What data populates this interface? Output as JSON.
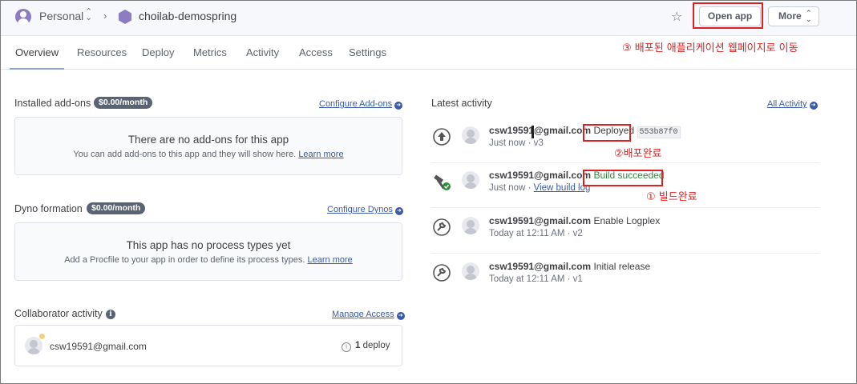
{
  "header": {
    "team": "Personal",
    "app_name": "choilab-demospring",
    "open_app": "Open app",
    "more": "More"
  },
  "tabs": [
    "Overview",
    "Resources",
    "Deploy",
    "Metrics",
    "Activity",
    "Access",
    "Settings"
  ],
  "addons": {
    "title": "Installed add-ons",
    "price": "$0.00/month",
    "link": "Configure Add-ons",
    "empty_title": "There are no add-ons for this app",
    "empty_desc": "You can add add-ons to this app and they will show here.",
    "learn_more": "Learn more"
  },
  "dynos": {
    "title": "Dyno formation",
    "price": "$0.00/month",
    "link": "Configure Dynos",
    "empty_title": "This app has no process types yet",
    "empty_desc": "Add a Procfile to your app in order to define its process types.",
    "learn_more": "Learn more"
  },
  "collaborators": {
    "title": "Collaborator activity",
    "link": "Manage Access",
    "email": "csw19591@gmail.com",
    "deploy_count": "1",
    "deploy_label": "deploy"
  },
  "activity": {
    "title": "Latest activity",
    "link": "All Activity",
    "items": [
      {
        "user": "csw19591@gmail.com",
        "action": "Deployed",
        "commit": "553b87f0",
        "time": "Just now",
        "version": "v3"
      },
      {
        "user": "csw19591@gmail.com",
        "action": "Build succeeded",
        "time": "Just now",
        "link": "View build log"
      },
      {
        "user": "csw19591@gmail.com",
        "action": "Enable Logplex",
        "time": "Today at 12:11 AM",
        "version": "v2"
      },
      {
        "user": "csw19591@gmail.com",
        "action": "Initial release",
        "time": "Today at 12:11 AM",
        "version": "v1"
      }
    ]
  },
  "annotations": {
    "open_app_note": "③ 배포된 애플리케이션 웹페이지로 이동",
    "deployed_note": "②배포완료",
    "build_note": "① 빌드완료"
  },
  "colors": {
    "annotation_red": "#e02020",
    "link_blue": "#3b5ba5",
    "success_green": "#2e8b3d",
    "app_hex_purple": "#8e7cc3"
  }
}
